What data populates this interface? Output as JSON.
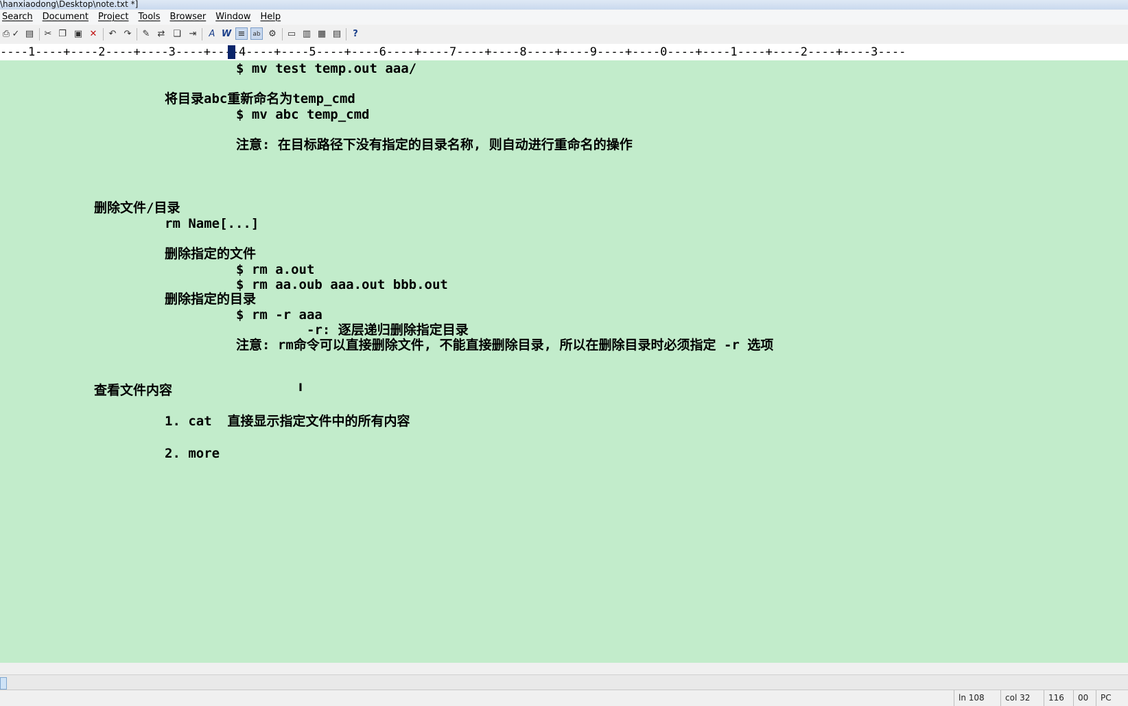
{
  "window": {
    "title": "\\hanxiaodong\\Desktop\\note.txt *]"
  },
  "menu": [
    "Search",
    "Document",
    "Project",
    "Tools",
    "Browser",
    "Window",
    "Help"
  ],
  "ruler": {
    "text": "----1----+----2----+----3----+----4----+----5----+----6----+----7----+----8----+----9----+----0----+----1----+----2----+----3----"
  },
  "editor": {
    "lines": [
      "$ mv test temp.out aaa/",
      "将目录abc重新命名为temp_cmd",
      "$ mv abc temp_cmd",
      "注意: 在目标路径下没有指定的目录名称, 则自动进行重命名的操作",
      "删除文件/目录",
      "rm Name[...]",
      "删除指定的文件",
      "$ rm a.out",
      "$ rm aa.oub aaa.out bbb.out",
      "删除指定的目录",
      "$ rm -r aaa",
      "-r: 逐层递归删除指定目录",
      "注意: rm命令可以直接删除文件, 不能直接删除目录, 所以在删除目录时必须指定 -r 选项",
      "查看文件内容",
      "1. cat  直接显示指定文件中的所有内容",
      "2. more"
    ],
    "text_cursor_glyph": "I"
  },
  "status": {
    "line": "ln 108",
    "col": "col 32",
    "chars": "116",
    "mode": "00",
    "format": "PC"
  },
  "colors": {
    "editor_bg": "#c2eccb",
    "ruler_cursor": "#0a246a"
  },
  "toolbar_icons": [
    "print-icon",
    "spellcheck-icon",
    "page-icon",
    "cut-icon",
    "copy-icon",
    "paste-icon",
    "delete-icon",
    "undo-icon",
    "redo-icon",
    "marker-icon",
    "replace-icon",
    "copy-doc-icon",
    "indent-icon",
    "font-icon",
    "wordwrap-icon",
    "column-mode-icon",
    "abc-icon",
    "settings-icon",
    "window1-icon",
    "window2-icon",
    "window3-icon",
    "window4-icon",
    "context-help-icon"
  ]
}
